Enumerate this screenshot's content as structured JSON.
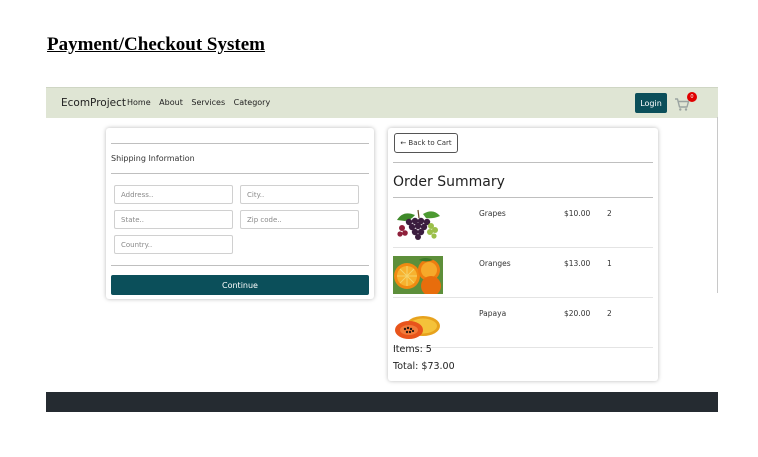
{
  "page": {
    "title": "Payment/Checkout System"
  },
  "navbar": {
    "brand": "EcomProject",
    "links": [
      {
        "label": "Home"
      },
      {
        "label": "About"
      },
      {
        "label": "Services"
      },
      {
        "label": "Category"
      }
    ],
    "login_label": "Login",
    "cart_count": "0"
  },
  "shipping": {
    "title": "Shipping Information",
    "address_placeholder": "Address..",
    "city_placeholder": "City..",
    "state_placeholder": "State..",
    "zip_placeholder": "Zip code..",
    "country_placeholder": "Country..",
    "continue_label": "Continue"
  },
  "order": {
    "back_label": "← Back to Cart",
    "title": "Order Summary",
    "items": [
      {
        "name": "Grapes",
        "price": "$10.00",
        "qty": "2",
        "icon": "grapes-image"
      },
      {
        "name": "Oranges",
        "price": "$13.00",
        "qty": "1",
        "icon": "oranges-image"
      },
      {
        "name": "Papaya",
        "price": "$20.00",
        "qty": "2",
        "icon": "papaya-image"
      }
    ],
    "items_count": "Items: 5",
    "total": "Total: $73.00"
  },
  "colors": {
    "navbar_bg": "#dfe5d4",
    "primary": "#0b4f5a",
    "badge": "#e00000",
    "footer": "#252b31"
  }
}
